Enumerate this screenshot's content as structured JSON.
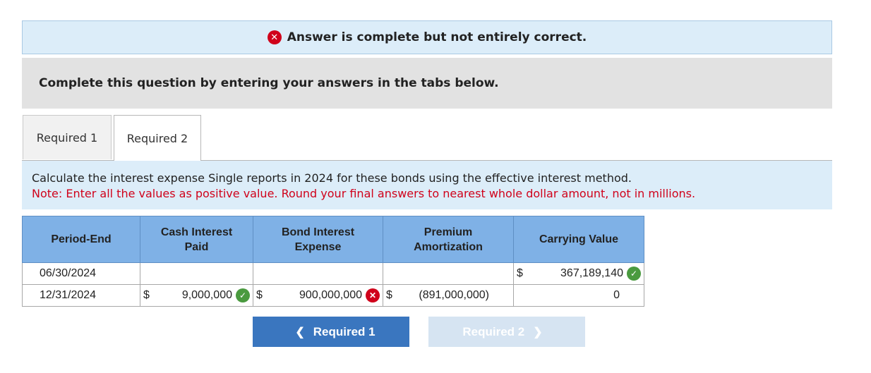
{
  "banner": {
    "text": "Answer is complete but not entirely correct."
  },
  "instructions": {
    "text": "Complete this question by entering your answers in the tabs below."
  },
  "tabs": [
    {
      "label": "Required 1"
    },
    {
      "label": "Required 2"
    }
  ],
  "question": {
    "text": "Calculate the interest expense Single reports in 2024 for these bonds using the effective interest method.",
    "note": "Note: Enter all the values as positive value. Round your final answers to nearest whole dollar amount, not in millions."
  },
  "table": {
    "headers": {
      "period": "Period-End",
      "cash_l1": "Cash Interest",
      "cash_l2": "Paid",
      "bond_l1": "Bond Interest",
      "bond_l2": "Expense",
      "prem_l1": "Premium",
      "prem_l2": "Amortization",
      "carrying": "Carrying Value"
    },
    "rows": [
      {
        "period": "06/30/2024",
        "cash": "",
        "bond": "",
        "premium": "",
        "carrying": "367,189,140",
        "carrying_symbol": "$"
      },
      {
        "period": "12/31/2024",
        "cash": "9,000,000",
        "cash_symbol": "$",
        "bond": "900,000,000",
        "bond_symbol": "$",
        "premium": "(891,000,000)",
        "premium_symbol": "$",
        "carrying": "0"
      }
    ]
  },
  "nav": {
    "prev_label": "Required 1",
    "next_label": "Required 2"
  },
  "icons": {
    "incorrect": "x-circle-icon",
    "correct": "check-circle-icon",
    "prev": "chevron-left-icon",
    "next": "chevron-right-icon"
  },
  "colors": {
    "incorrect": "#d0021b",
    "correct": "#4a9a3f",
    "header_bg": "#7fb1e6",
    "primary_button": "#3a76bf"
  }
}
